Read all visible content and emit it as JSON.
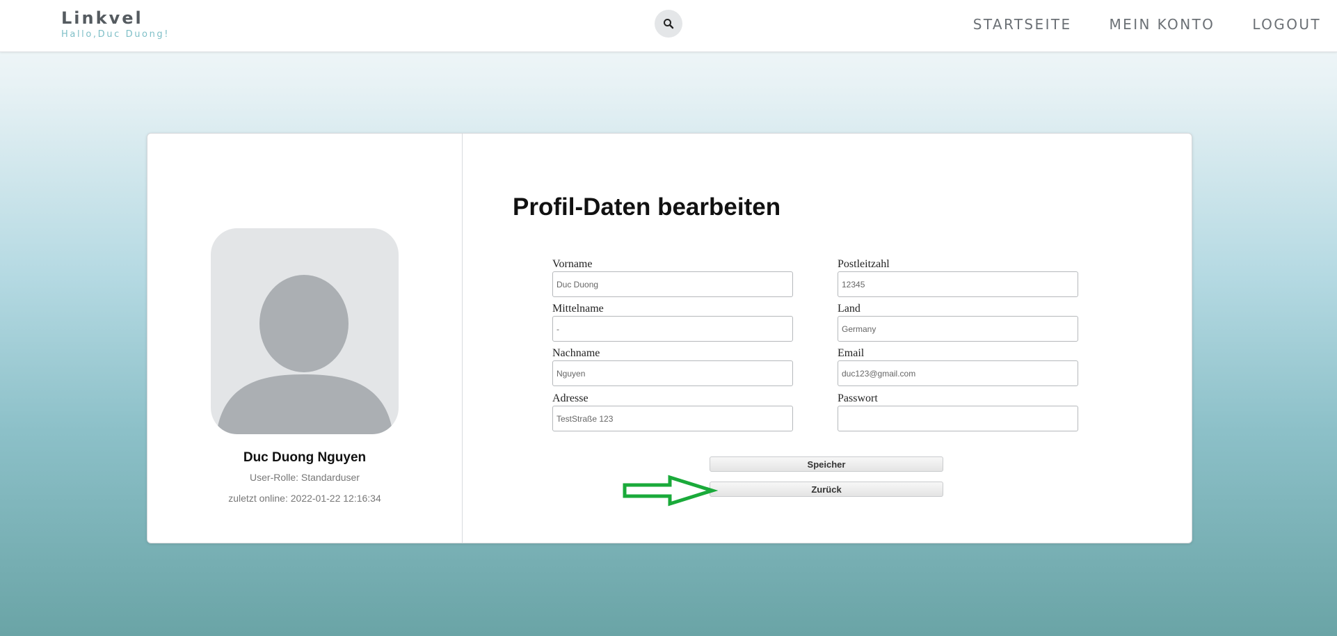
{
  "header": {
    "brand": "Linkvel",
    "greeting": "Hallo,Duc Duong!",
    "nav": [
      "STARTSEITE",
      "MEIN KONTO",
      "LOGOUT"
    ]
  },
  "profile": {
    "name": "Duc Duong Nguyen",
    "role": "User-Rolle: Standarduser",
    "last_online": "zuletzt online: 2022-01-22 12:16:34"
  },
  "form": {
    "title": "Profil-Daten bearbeiten",
    "fields": [
      {
        "label": "Vorname",
        "value": "Duc Duong"
      },
      {
        "label": "Mittelname",
        "value": "-"
      },
      {
        "label": "Nachname",
        "value": "Nguyen"
      },
      {
        "label": "Adresse",
        "value": "TestStraße 123"
      },
      {
        "label": "Postleitzahl",
        "value": "12345"
      },
      {
        "label": "Land",
        "value": "Germany"
      },
      {
        "label": "Email",
        "value": "duc123@gmail.com"
      },
      {
        "label": "Passwort",
        "value": ""
      }
    ],
    "save_label": "Speicher",
    "back_label": "Zurück"
  },
  "colors": {
    "brand_text": "#555b60",
    "greeting_text": "#7fbfc7",
    "annotation_arrow": "#1aaa3a"
  }
}
